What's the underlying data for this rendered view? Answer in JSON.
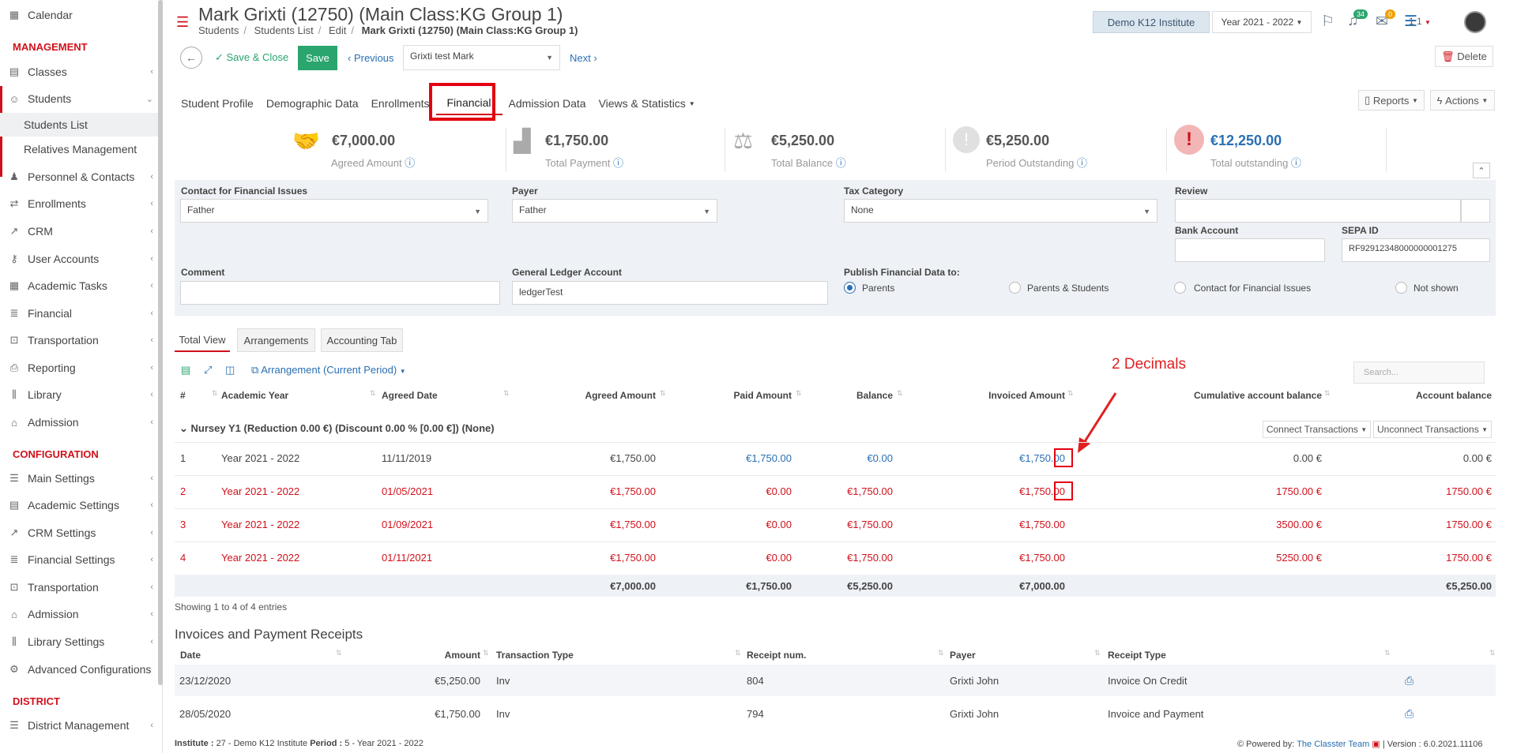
{
  "sidebar": {
    "calendar": "Calendar",
    "sec_management": "MANAGEMENT",
    "classes": "Classes",
    "students": "Students",
    "students_list": "Students List",
    "relatives": "Relatives Management",
    "personnel": "Personnel & Contacts",
    "enrollments": "Enrollments",
    "crm": "CRM",
    "user_accounts": "User Accounts",
    "academic_tasks": "Academic Tasks",
    "financial": "Financial",
    "transportation": "Transportation",
    "reporting": "Reporting",
    "library": "Library",
    "admission": "Admission",
    "sec_configuration": "CONFIGURATION",
    "main_settings": "Main Settings",
    "academic_settings": "Academic Settings",
    "crm_settings": "CRM Settings",
    "financial_settings": "Financial Settings",
    "transportation2": "Transportation",
    "admission2": "Admission",
    "library_settings": "Library Settings",
    "advanced": "Advanced Configurations",
    "sec_district": "DISTRICT",
    "district_mgmt": "District Management"
  },
  "header": {
    "title": "Mark Grixti (12750) (Main Class:KG Group 1)",
    "bc_students": "Students",
    "bc_list": "Students List",
    "bc_edit": "Edit",
    "bc_current": "Mark Grixti (12750) (Main Class:KG Group 1)",
    "institute": "Demo K12 Institute",
    "year": "Year 2021 - 2022",
    "notif_count": "34",
    "mail_count": "0",
    "user_num": "1 1"
  },
  "toolbar": {
    "save_close": "Save & Close",
    "save": "Save",
    "previous": "Previous",
    "student": "Grixti test Mark",
    "next": "Next",
    "delete": "Delete"
  },
  "tabs": [
    "Student Profile",
    "Demographic Data",
    "Enrollments",
    "Financial",
    "Admission Data",
    "Views & Statistics"
  ],
  "reports": "Reports",
  "actions": "Actions",
  "summary": [
    {
      "value": "€7,000.00",
      "label": "Agreed Amount"
    },
    {
      "value": "€1,750.00",
      "label": "Total Payment"
    },
    {
      "value": "€5,250.00",
      "label": "Total Balance"
    },
    {
      "value": "€5,250.00",
      "label": "Period Outstanding"
    },
    {
      "value": "€12,250.00",
      "label": "Total outstanding"
    }
  ],
  "form": {
    "contact_lbl": "Contact for Financial Issues",
    "contact_val": "Father",
    "payer_lbl": "Payer",
    "payer_val": "Father",
    "tax_lbl": "Tax Category",
    "tax_val": "None",
    "review_lbl": "Review",
    "bank_lbl": "Bank Account",
    "sepa_lbl": "SEPA ID",
    "sepa_val": "RF92912348000000001275",
    "comment_lbl": "Comment",
    "ledger_lbl": "General Ledger Account",
    "ledger_val": "ledgerTest",
    "publish_lbl": "Publish Financial Data to:",
    "opt_parents": "Parents",
    "opt_ps": "Parents & Students",
    "opt_contact": "Contact for Financial Issues",
    "opt_none": "Not shown"
  },
  "subtabs": [
    "Total View",
    "Arrangements",
    "Accounting Tab"
  ],
  "arrangement_btn": "Arrangement (Current Period)",
  "search_placeholder": "Search...",
  "annotation": "2 Decimals",
  "cols": [
    "#",
    "Academic Year",
    "Agreed Date",
    "Agreed Amount",
    "Paid Amount",
    "Balance",
    "Invoiced Amount",
    "Cumulative account balance",
    "Account balance"
  ],
  "group_label": "Nursey Y1 (Reduction 0.00 €) (Discount 0.00 % [0.00 €]) (None)",
  "connect": "Connect Transactions",
  "unconnect": "Unconnect Transactions",
  "rows": [
    {
      "n": "1",
      "year": "Year 2021 - 2022",
      "date": "11/11/2019",
      "agreed": "€1,750.00",
      "paid": "€1,750.00",
      "balance": "€0.00",
      "invoiced": "€1,750.00",
      "cum": "0.00 €",
      "acc": "0.00 €"
    },
    {
      "n": "2",
      "year": "Year 2021 - 2022",
      "date": "01/05/2021",
      "agreed": "€1,750.00",
      "paid": "€0.00",
      "balance": "€1,750.00",
      "invoiced": "€1,750.00",
      "cum": "1750.00 €",
      "acc": "1750.00 €"
    },
    {
      "n": "3",
      "year": "Year 2021 - 2022",
      "date": "01/09/2021",
      "agreed": "€1,750.00",
      "paid": "€0.00",
      "balance": "€1,750.00",
      "invoiced": "€1,750.00",
      "cum": "3500.00 €",
      "acc": "1750.00 €"
    },
    {
      "n": "4",
      "year": "Year 2021 - 2022",
      "date": "01/11/2021",
      "agreed": "€1,750.00",
      "paid": "€0.00",
      "balance": "€1,750.00",
      "invoiced": "€1,750.00",
      "cum": "5250.00 €",
      "acc": "1750.00 €"
    }
  ],
  "totals": {
    "agreed": "€7,000.00",
    "paid": "€1,750.00",
    "balance": "€5,250.00",
    "invoiced": "€7,000.00",
    "acc": "€5,250.00"
  },
  "showing": "Showing 1 to 4 of 4 entries",
  "invoices_title": "Invoices and Payment Receipts",
  "inv_cols": [
    "Date",
    "Amount",
    "Transaction Type",
    "Receipt num.",
    "Payer",
    "Receipt Type"
  ],
  "inv_rows": [
    {
      "date": "23/12/2020",
      "amount": "€5,250.00",
      "type": "Inv",
      "num": "804",
      "payer": "Grixti John",
      "rtype": "Invoice On Credit"
    },
    {
      "date": "28/05/2020",
      "amount": "€1,750.00",
      "type": "Inv",
      "num": "794",
      "payer": "Grixti John",
      "rtype": "Invoice and Payment"
    }
  ],
  "footer": {
    "inst_lbl": "Institute :",
    "inst_val": "27 - Demo K12 Institute",
    "period_lbl": "Period :",
    "period_val": "5 - Year 2021 - 2022",
    "powered": "Powered by:",
    "team": "The Classter Team",
    "version": "| Version : 6.0.2021.11106"
  }
}
